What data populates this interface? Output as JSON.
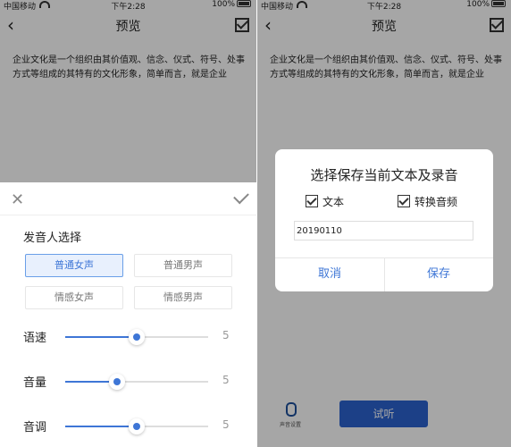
{
  "status_bar": {
    "carrier": "中国移动",
    "time": "下午2:28",
    "battery": "100%"
  },
  "nav": {
    "title": "预览"
  },
  "content_text": "企业文化是一个组织由其价值观、信念、仪式、符号、处事方式等组成的其特有的文化形象，简单而言，就是企业",
  "voice_sheet": {
    "heading": "发音人选择",
    "voices": [
      {
        "label": "普通女声",
        "selected": true
      },
      {
        "label": "普通男声",
        "selected": false
      },
      {
        "label": "情感女声",
        "selected": false
      },
      {
        "label": "情感男声",
        "selected": false
      }
    ],
    "sliders": [
      {
        "label": "语速",
        "value": "5",
        "fraction": 0.5
      },
      {
        "label": "音量",
        "value": "5",
        "fraction": 0.36
      },
      {
        "label": "音调",
        "value": "5",
        "fraction": 0.5
      }
    ]
  },
  "save_dialog": {
    "title": "选择保存当前文本及录音",
    "option_text": "文本",
    "option_audio": "转换音频",
    "filename": "20190110",
    "cancel": "取消",
    "save": "保存"
  },
  "bottom": {
    "mic_label": "声音设置",
    "try_label": "试听"
  },
  "colors": {
    "accent": "#3e76d6",
    "primary_button": "#2b63d0"
  }
}
